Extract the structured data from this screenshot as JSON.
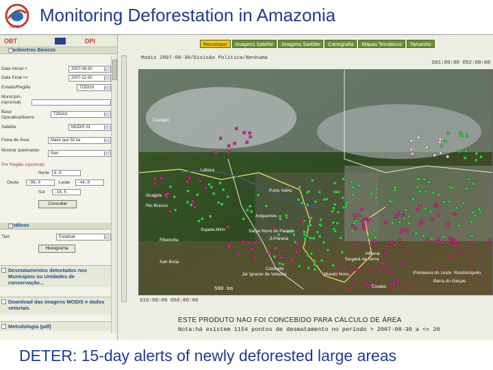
{
  "slide": {
    "title": "Monitoring Deforestation in Amazonia",
    "caption": "DETER: 15-day alerts of newly deforested large areas"
  },
  "left_panel": {
    "brand_left": "OBT",
    "brand_right": "DPI",
    "section_params": "Parâmetros Básicos",
    "fields": {
      "data_inicial_label": "Data Inicial >",
      "data_inicial_value": "2007-08-30",
      "data_final_label": "Data Final <=",
      "data_final_value": "2007-12-30",
      "estado_label": "Estado/Região",
      "estado_value": "TODOS",
      "municipio_label": "Município (opcional)",
      "base_label": "Base Operativa/Ibama",
      "base_value": "TODAS",
      "satelite_label": "Satélite",
      "satelite_value": "MODIS 01",
      "faixa_label": "Faixa de Área",
      "faixa_value": "Maior que 50 ha",
      "mostrar_label": "Mostrar queimadas",
      "mostrar_value": "Nao",
      "regiao_label": "Por Região (opcional)",
      "norte_label": "Norte",
      "norte_value": "6.0",
      "oeste_label": "Oeste",
      "oeste_value": "-90.0",
      "leste_label": "Leste",
      "leste_value": "-44.0",
      "sul_label": "Sul",
      "sul_value": "-18.5"
    },
    "consultar_label": "Consultar",
    "section_graficos": "Gráficos",
    "tipo_label": "Tipo",
    "tipo_value": "Estadual",
    "histograma_label": "Histograma",
    "section_desmatamentos": "Desmatamentos detectados nos Municípios ou Unidades de conservação...",
    "section_download": "Download das imagens MODIS e dados vetoriais",
    "section_metodologia": "Metodologia (pdf)"
  },
  "right_area": {
    "tabs": [
      "Recompor",
      "Imagens Satélite",
      "Imagens Satélite",
      "Cartografia",
      "Mapas Temáticos",
      "Tamanho"
    ],
    "active_tab_index": 0,
    "map_header": "Modis 2007-08-30/Divisão Política/Nenhuma",
    "coord_top_right": "S01:00:00 O52:00:00",
    "coord_bottom_left": "S16:00:00 O66:00:00",
    "scale_label": "500 km",
    "footer_line1": "ESTE PRODUTO NAO FOI CONCEBIDO PARA CÁLCULO DE ÁREA",
    "footer_line2": "Nota:há existem 1154 pontos de desmatamento no período > 2007-08-30 a <= 20",
    "map_labels": [
      "Cavajari",
      "Lábrea",
      "Porto Velho",
      "Ariquemes",
      "Sarpo Novo do Parecis",
      "Ji-Paraná",
      "Sujada Mirin",
      "Ribeirolta",
      "Cuiabá",
      "Tangará da Serra",
      "San Borja",
      "Jar Ignacio de Velasco",
      "Primavera do Leste",
      "Barra do Garças",
      "Mundo Novo",
      "Colorado",
      "Vilhena",
      "Rondonópolis",
      "Guajara",
      "Rio Branco"
    ]
  },
  "colors": {
    "title": "#1f3a93",
    "alert_magenta": "#e0198f",
    "alert_green": "#2ecc40",
    "panel_bg": "#f3f3ea"
  }
}
